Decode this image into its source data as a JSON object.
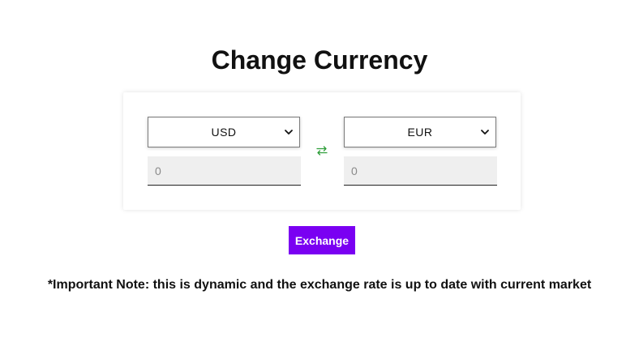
{
  "header": {
    "title": "Change Currency"
  },
  "converter": {
    "from_currency": "USD",
    "to_currency": "EUR",
    "from_amount_placeholder": "0",
    "to_amount_placeholder": "0",
    "swap_icon": "swap-arrows-icon"
  },
  "actions": {
    "exchange_label": "Exchange"
  },
  "footer": {
    "note": "*Important Note: this is dynamic and the exchange rate is up to date with current market"
  },
  "colors": {
    "accent": "#7a00f2",
    "swap_icon": "#2e9e3a",
    "input_background": "#efefef"
  }
}
